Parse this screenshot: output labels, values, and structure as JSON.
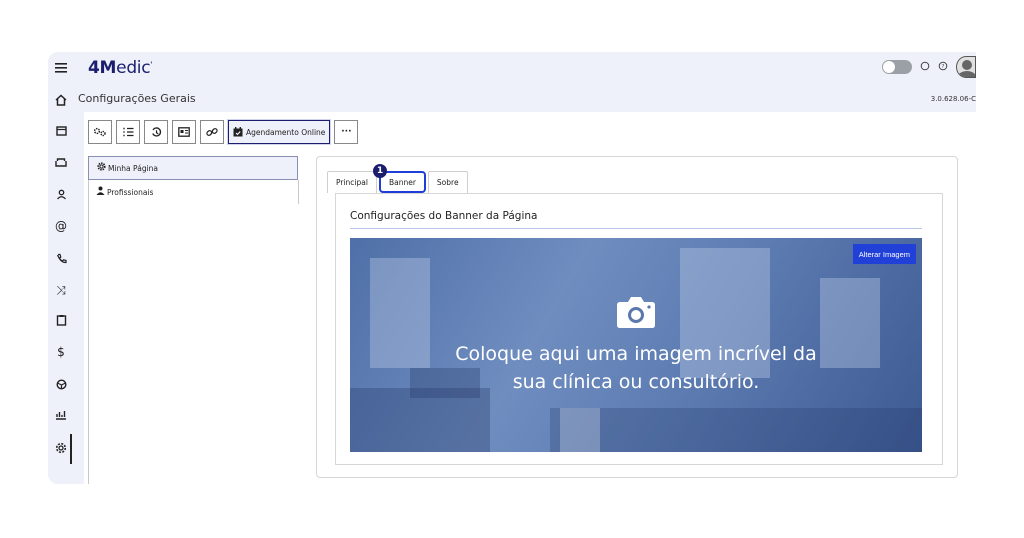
{
  "app": {
    "logo_bold": "4M",
    "logo_rest": "edic",
    "logo_mark": "'"
  },
  "header": {
    "page_title": "Configurações Gerais",
    "version": "3.0.628.06-C"
  },
  "toolbar": {
    "items": [
      {
        "name": "settings-gears",
        "glyph": "⚙"
      },
      {
        "name": "list-numbered",
        "glyph": "☰"
      },
      {
        "name": "history",
        "glyph": "↺"
      },
      {
        "name": "id-card",
        "glyph": "▤"
      },
      {
        "name": "link",
        "glyph": "⚯"
      }
    ],
    "active_label": "Agendamento Online",
    "more_glyph": "···"
  },
  "left_panel": {
    "items": [
      {
        "label": "Minha Página",
        "selected": true
      },
      {
        "label": "Profissionais",
        "selected": false
      }
    ]
  },
  "tabs": {
    "principal": "Principal",
    "banner": "Banner",
    "sobre": "Sobre",
    "badge": "1"
  },
  "banner_section": {
    "title": "Configurações do Banner da Página",
    "change_button": "Alterar Imagem",
    "placeholder_line1": "Coloque aqui uma imagem incrível da",
    "placeholder_line2": "sua clínica ou consultório."
  },
  "icons": {
    "menu": "menu-icon",
    "home": "home-icon",
    "calendar": "calendar-icon",
    "accent": "#1b1d6e",
    "button_blue": "#2040d8"
  }
}
